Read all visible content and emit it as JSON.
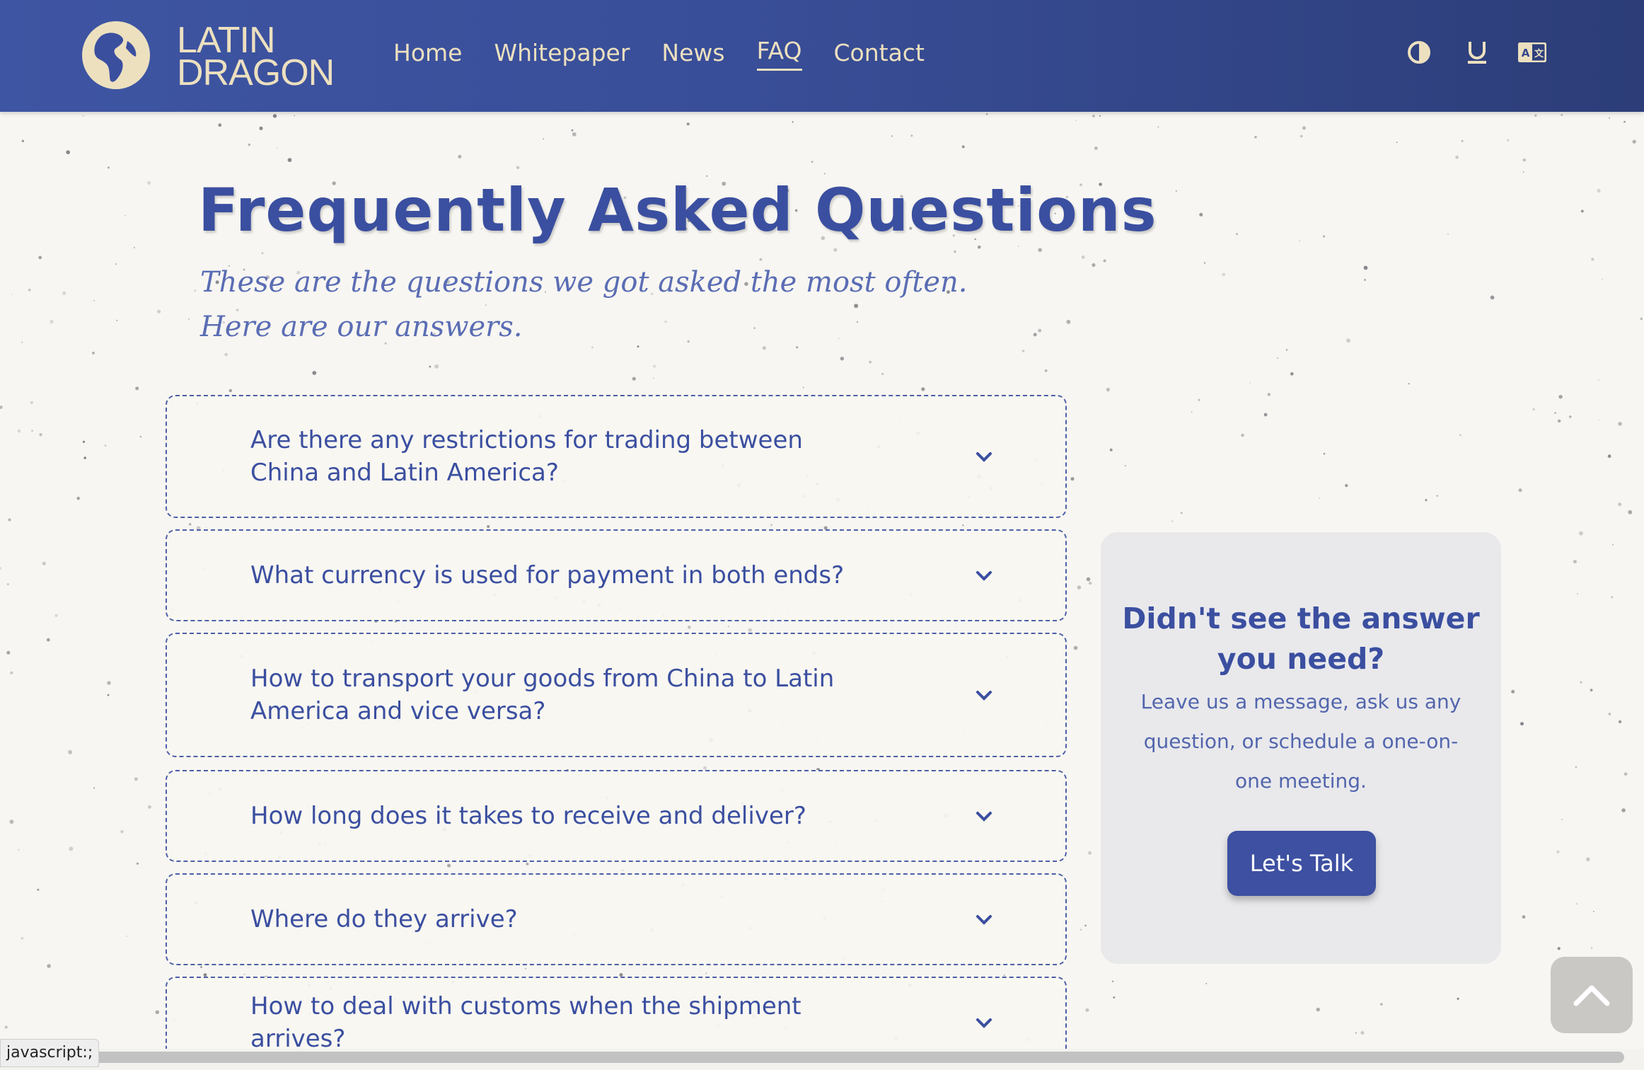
{
  "header": {
    "logo_line1": "LATIN",
    "logo_line2": "DRAGON",
    "nav": [
      {
        "label": "Home"
      },
      {
        "label": "Whitepaper"
      },
      {
        "label": "News"
      },
      {
        "label": "FAQ",
        "active": true
      },
      {
        "label": "Contact"
      }
    ],
    "tools": [
      {
        "icon": "contrast-icon"
      },
      {
        "icon": "underline-icon"
      },
      {
        "icon": "translate-icon"
      }
    ]
  },
  "hero": {
    "title": "Frequently Asked Questions",
    "subtitle": "These are the questions we got asked the most often. Here are our answers."
  },
  "faq": [
    {
      "question": "Are there any restrictions for trading between China and Latin America?"
    },
    {
      "question": "What currency is used for payment in both ends?"
    },
    {
      "question": "How to transport your goods from China to Latin America and vice versa?"
    },
    {
      "question": "How long does it takes to receive and deliver?"
    },
    {
      "question": "Where do they arrive?"
    },
    {
      "question": "How to deal with customs when the shipment arrives?"
    }
  ],
  "card": {
    "title": "Didn't see the answer you need?",
    "text": "Leave us a message, ask us any question, or schedule a one-on-one meeting.",
    "button": "Let's Talk"
  },
  "status_bar": {
    "url": "javascript:;"
  },
  "colors": {
    "primary": "#3b4fa0",
    "header_start": "#3e55a3",
    "header_end": "#2c3d78",
    "cream": "#ece0bf",
    "background": "#f7f6f2",
    "card_bg": "#e9e9ec"
  }
}
